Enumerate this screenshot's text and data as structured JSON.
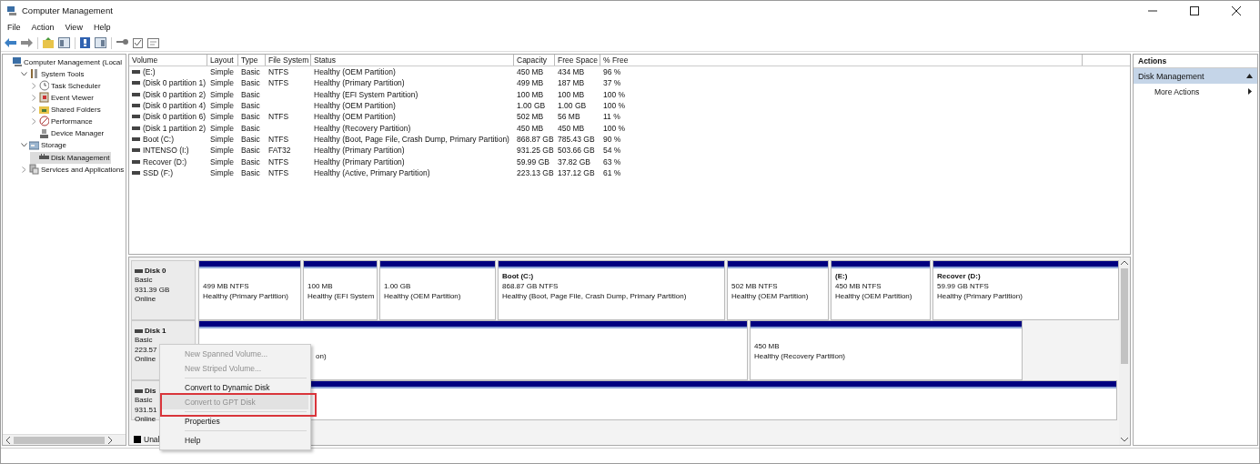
{
  "window": {
    "title": "Computer Management"
  },
  "menu_bar": [
    "File",
    "Action",
    "View",
    "Help"
  ],
  "tree": [
    {
      "label": "Computer Management (Local",
      "selected": false,
      "children": [
        {
          "label": "System Tools",
          "expanded": true,
          "selected": false,
          "children": [
            {
              "label": "Task Scheduler",
              "expanded": false,
              "selected": false
            },
            {
              "label": "Event Viewer",
              "expanded": false,
              "selected": false
            },
            {
              "label": "Shared Folders",
              "expanded": false,
              "selected": false
            },
            {
              "label": "Performance",
              "expanded": false,
              "selected": false
            },
            {
              "label": "Device Manager",
              "selected": false
            }
          ]
        },
        {
          "label": "Storage",
          "expanded": true,
          "selected": false,
          "children": [
            {
              "label": "Disk Management",
              "selected": true
            }
          ]
        },
        {
          "label": "Services and Applications",
          "expanded": false,
          "selected": false
        }
      ]
    }
  ],
  "volume_table": {
    "columns": [
      "Volume",
      "Layout",
      "Type",
      "File System",
      "Status",
      "Capacity",
      "Free Space",
      "% Free"
    ],
    "rows": [
      [
        "(E:)",
        "Simple",
        "Basic",
        "NTFS",
        "Healthy (OEM Partition)",
        "450 MB",
        "434 MB",
        "96 %"
      ],
      [
        "(Disk 0 partition 1)",
        "Simple",
        "Basic",
        "NTFS",
        "Healthy (Primary Partition)",
        "499 MB",
        "187 MB",
        "37 %"
      ],
      [
        "(Disk 0 partition 2)",
        "Simple",
        "Basic",
        "",
        "Healthy (EFI System Partition)",
        "100 MB",
        "100 MB",
        "100 %"
      ],
      [
        "(Disk 0 partition 4)",
        "Simple",
        "Basic",
        "",
        "Healthy (OEM Partition)",
        "1.00 GB",
        "1.00 GB",
        "100 %"
      ],
      [
        "(Disk 0 partition 6)",
        "Simple",
        "Basic",
        "NTFS",
        "Healthy (OEM Partition)",
        "502 MB",
        "56 MB",
        "11 %"
      ],
      [
        "(Disk 1 partition 2)",
        "Simple",
        "Basic",
        "",
        "Healthy (Recovery Partition)",
        "450 MB",
        "450 MB",
        "100 %"
      ],
      [
        "Boot (C:)",
        "Simple",
        "Basic",
        "NTFS",
        "Healthy (Boot, Page File, Crash Dump, Primary Partition)",
        "868.87 GB",
        "785.43 GB",
        "90 %"
      ],
      [
        "INTENSO (I:)",
        "Simple",
        "Basic",
        "FAT32",
        "Healthy (Primary Partition)",
        "931.25 GB",
        "503.66 GB",
        "54 %"
      ],
      [
        "Recover (D:)",
        "Simple",
        "Basic",
        "NTFS",
        "Healthy (Primary Partition)",
        "59.99 GB",
        "37.82 GB",
        "63 %"
      ],
      [
        "SSD (F:)",
        "Simple",
        "Basic",
        "NTFS",
        "Healthy (Active, Primary Partition)",
        "223.13 GB",
        "137.12 GB",
        "61 %"
      ]
    ]
  },
  "disks": [
    {
      "name": "Disk 0",
      "type": "Basic",
      "size": "931.39 GB",
      "status": "Online",
      "partitions": [
        {
          "kind": "plain",
          "size": "499 MB NTFS",
          "status": "Healthy (Primary Partition)"
        },
        {
          "kind": "plain",
          "size": "100 MB",
          "status": "Healthy (EFI System"
        },
        {
          "kind": "plain",
          "size": "1.00 GB",
          "status": "Healthy (OEM Partition)"
        },
        {
          "kind": "plain",
          "title": "Boot  (C:)",
          "size": "868.87 GB NTFS",
          "status": "Healthy (Boot, Page File, Crash Dump, Primary Partition)"
        },
        {
          "kind": "plain",
          "size": "502 MB NTFS",
          "status": "Healthy (OEM Partition)"
        },
        {
          "kind": "plain",
          "title": "(E:)",
          "size": "450 MB NTFS",
          "status": "Healthy (OEM Partition)"
        },
        {
          "kind": "plain",
          "title": "Recover  (D:)",
          "size": "59.99 GB NTFS",
          "status": "Healthy (Primary Partition)"
        }
      ]
    },
    {
      "name": "Disk 1",
      "type": "Basic",
      "size": "223.57",
      "status": "Online",
      "partitions": [
        {
          "kind": "covered",
          "status": "on)"
        },
        {
          "kind": "plain",
          "size": "450 MB",
          "status": "Healthy (Recovery Partition)"
        }
      ]
    },
    {
      "name": "Dis",
      "type": "Basic",
      "size": "931.51",
      "status": "Online",
      "partitions": [
        {
          "kind": "covered"
        }
      ]
    }
  ],
  "legend": {
    "label": "Unal"
  },
  "context_menu": [
    {
      "kind": "item",
      "label": "New Spanned Volume...",
      "disabled": true,
      "selected": false
    },
    {
      "kind": "item",
      "label": "New Striped Volume...",
      "disabled": true,
      "selected": false
    },
    {
      "kind": "separator"
    },
    {
      "kind": "item",
      "label": "Convert to Dynamic Disk",
      "disabled": false,
      "selected": false
    },
    {
      "kind": "item",
      "label": "Convert to GPT Disk",
      "disabled": true,
      "selected": true
    },
    {
      "kind": "separator"
    },
    {
      "kind": "item",
      "label": "Properties",
      "disabled": false,
      "selected": false
    },
    {
      "kind": "separator"
    },
    {
      "kind": "item",
      "label": "Help",
      "disabled": false,
      "selected": false
    }
  ],
  "actions": {
    "title": "Actions",
    "section": "Disk Management",
    "items": [
      "More Actions"
    ]
  }
}
